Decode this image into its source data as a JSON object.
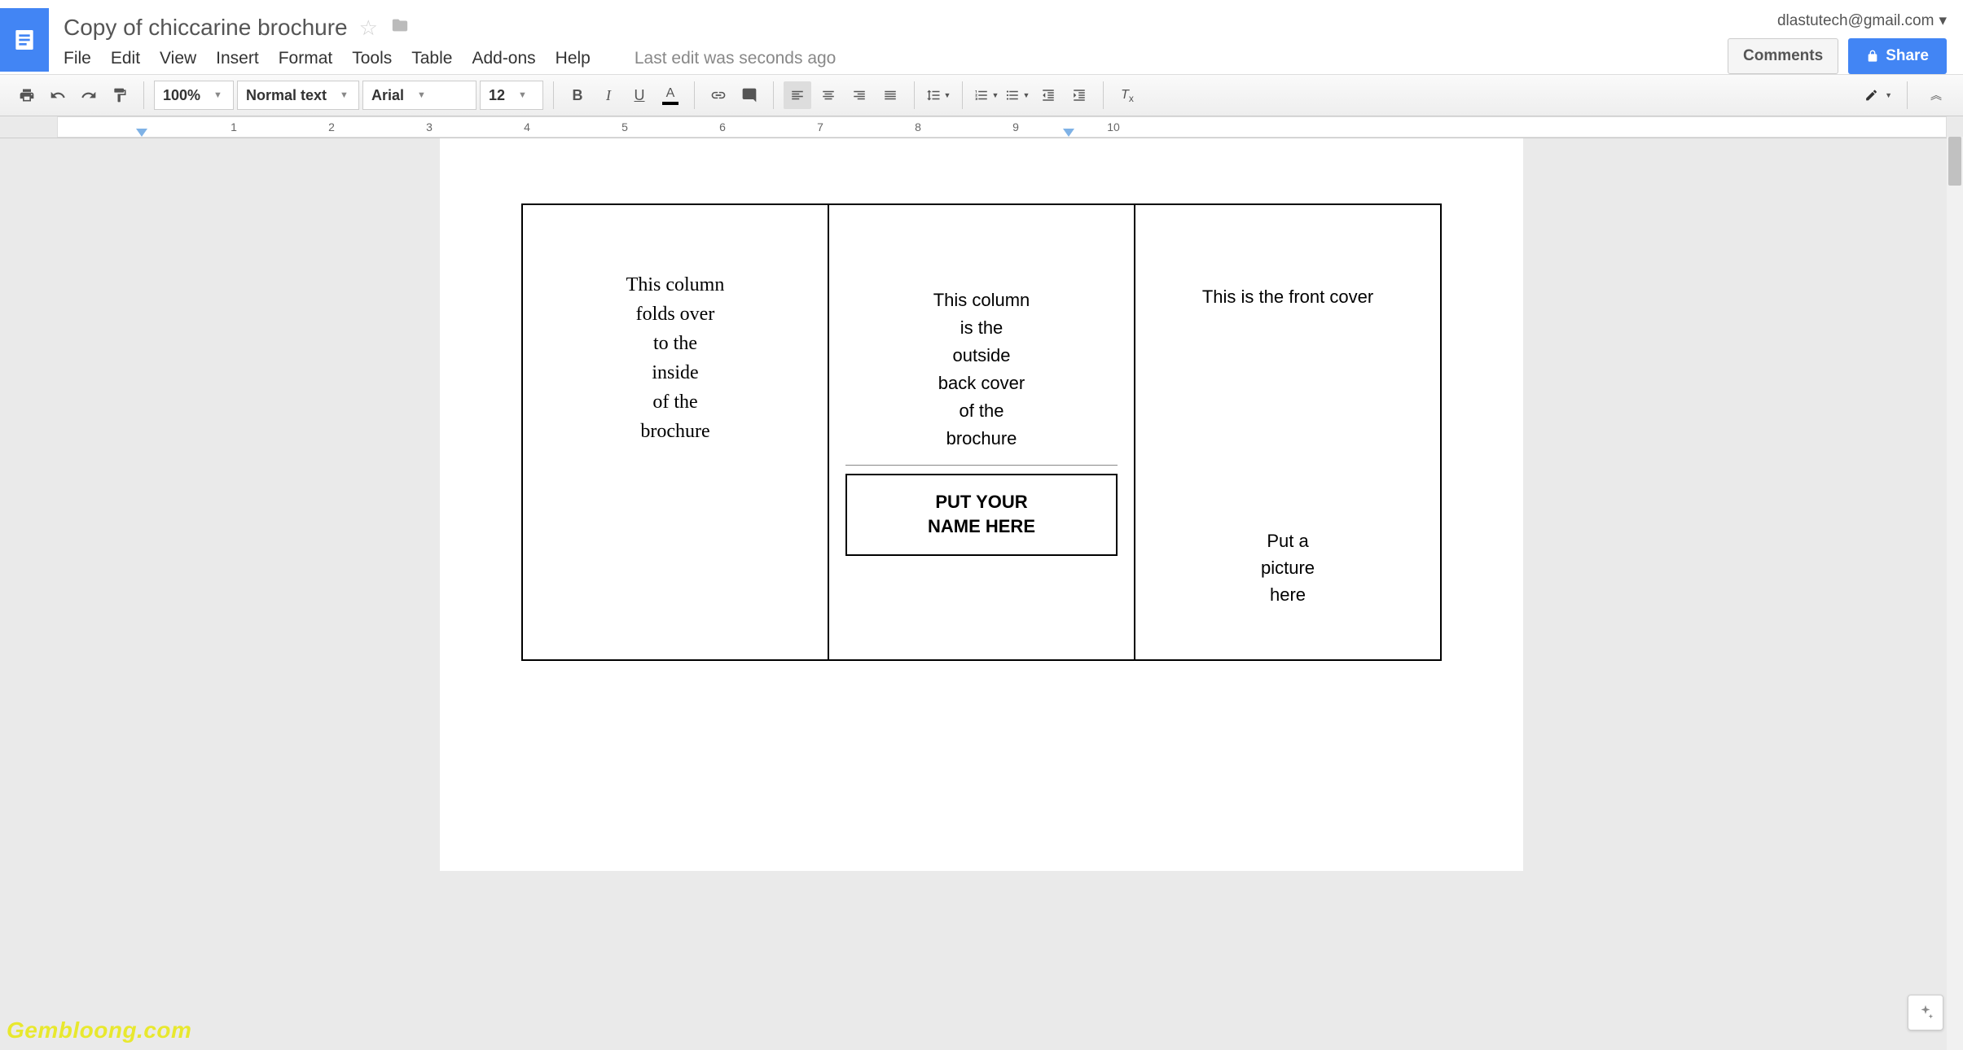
{
  "header": {
    "doc_title": "Copy of chiccarine brochure",
    "user_email": "dlastutech@gmail.com",
    "comments_label": "Comments",
    "share_label": "Share",
    "last_edit": "Last edit was seconds ago"
  },
  "menubar": [
    "File",
    "Edit",
    "View",
    "Insert",
    "Format",
    "Tools",
    "Table",
    "Add-ons",
    "Help"
  ],
  "toolbar": {
    "zoom": "100%",
    "style": "Normal text",
    "font": "Arial",
    "size": "12"
  },
  "ruler_numbers": [
    "1",
    "2",
    "3",
    "4",
    "5",
    "6",
    "7",
    "8",
    "9",
    "10"
  ],
  "document": {
    "col1": "This column\nfolds over\nto the\ninside\nof the\nbrochure",
    "col2_top": "This column\nis the\noutside\nback cover\nof the\nbrochure",
    "col2_box": "PUT YOUR\nNAME HERE",
    "col3_top": "This is the front cover",
    "col3_bottom": "Put a\npicture\nhere"
  },
  "watermark": "Gembloong.com"
}
